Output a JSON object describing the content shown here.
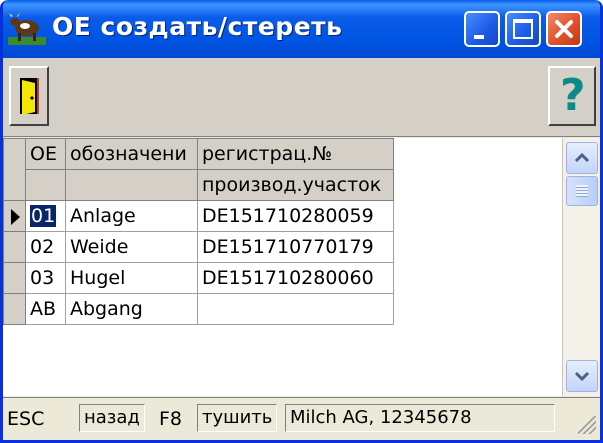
{
  "window": {
    "title": "OE  создать/стереть",
    "icon": "cow-icon"
  },
  "toolbar": {
    "exit_icon": "door-exit-icon",
    "help_icon": "help-icon",
    "help_glyph": "?"
  },
  "grid": {
    "columns": [
      {
        "header_line1": "OE",
        "header_line2": ""
      },
      {
        "header_line1": "обозначени",
        "header_line2": ""
      },
      {
        "header_line1": "регистрац.№",
        "header_line2": "производ.участок"
      }
    ],
    "rows": [
      {
        "oe": "01",
        "name": "Anlage",
        "reg": "DE151710280059",
        "current": true
      },
      {
        "oe": "02",
        "name": "Weide",
        "reg": "DE151710770179",
        "current": false
      },
      {
        "oe": "03",
        "name": "Hugel",
        "reg": "DE151710280060",
        "current": false
      },
      {
        "oe": "AB",
        "name": "Abgang",
        "reg": "",
        "current": false
      }
    ]
  },
  "statusbar": {
    "key1": "ESC",
    "action1": "назад",
    "key2": "F8",
    "action2": "тушить",
    "info": "Milch AG, 12345678"
  },
  "colors": {
    "title_bar": "#0054e3",
    "selection": "#0a246a",
    "face": "#d4d0c8"
  }
}
